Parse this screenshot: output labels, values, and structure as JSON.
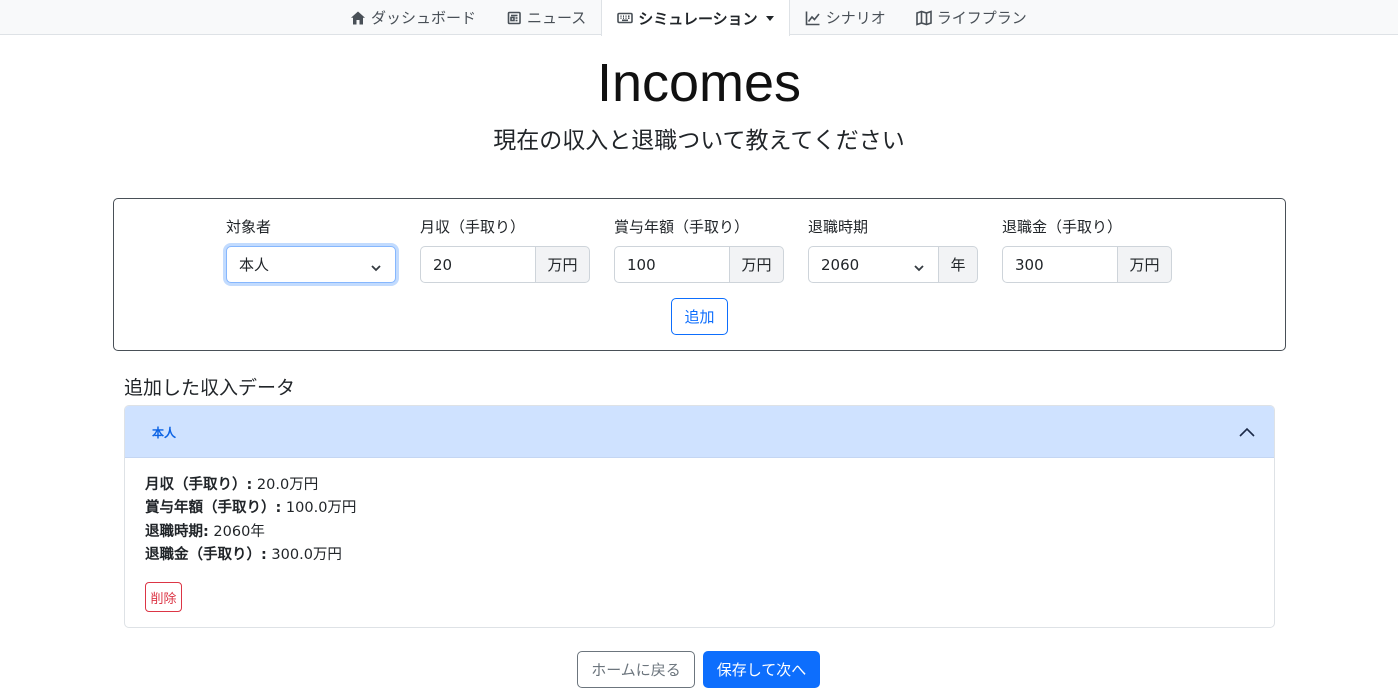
{
  "nav": {
    "tabs": [
      {
        "label": "ダッシュボード",
        "icon": "house-icon"
      },
      {
        "label": "ニュース",
        "icon": "newspaper-icon"
      },
      {
        "label": "シミュレーション",
        "icon": "keyboard-icon",
        "active": true
      },
      {
        "label": "シナリオ",
        "icon": "chart-line-icon"
      },
      {
        "label": "ライフプラン",
        "icon": "map-icon"
      }
    ]
  },
  "header": {
    "title": "Incomes",
    "subtitle": "現在の収入と退職ついて教えてください"
  },
  "form": {
    "target": {
      "label": "対象者",
      "value": "本人"
    },
    "monthly": {
      "label": "月収（手取り）",
      "value": "20",
      "unit": "万円"
    },
    "bonus": {
      "label": "賞与年額（手取り）",
      "value": "100",
      "unit": "万円"
    },
    "retire_year": {
      "label": "退職時期",
      "value": "2060",
      "unit": "年"
    },
    "severance": {
      "label": "退職金（手取り）",
      "value": "300",
      "unit": "万円"
    },
    "add_label": "追加"
  },
  "list": {
    "title": "追加した収入データ",
    "items": [
      {
        "name": "本人",
        "monthly_label": "月収（手取り）:",
        "monthly_value": " 20.0万円",
        "bonus_label": "賞与年額（手取り）:",
        "bonus_value": " 100.0万円",
        "retire_label": "退職時期:",
        "retire_value": " 2060年",
        "severance_label": "退職金（手取り）:",
        "severance_value": " 300.0万円",
        "delete_label": "削除"
      }
    ]
  },
  "footer": {
    "home_label": "ホームに戻る",
    "save_label": "保存して次へ"
  },
  "colors": {
    "primary": "#0d6efd",
    "danger": "#dc3545",
    "accordion_bg": "#cfe2ff"
  }
}
